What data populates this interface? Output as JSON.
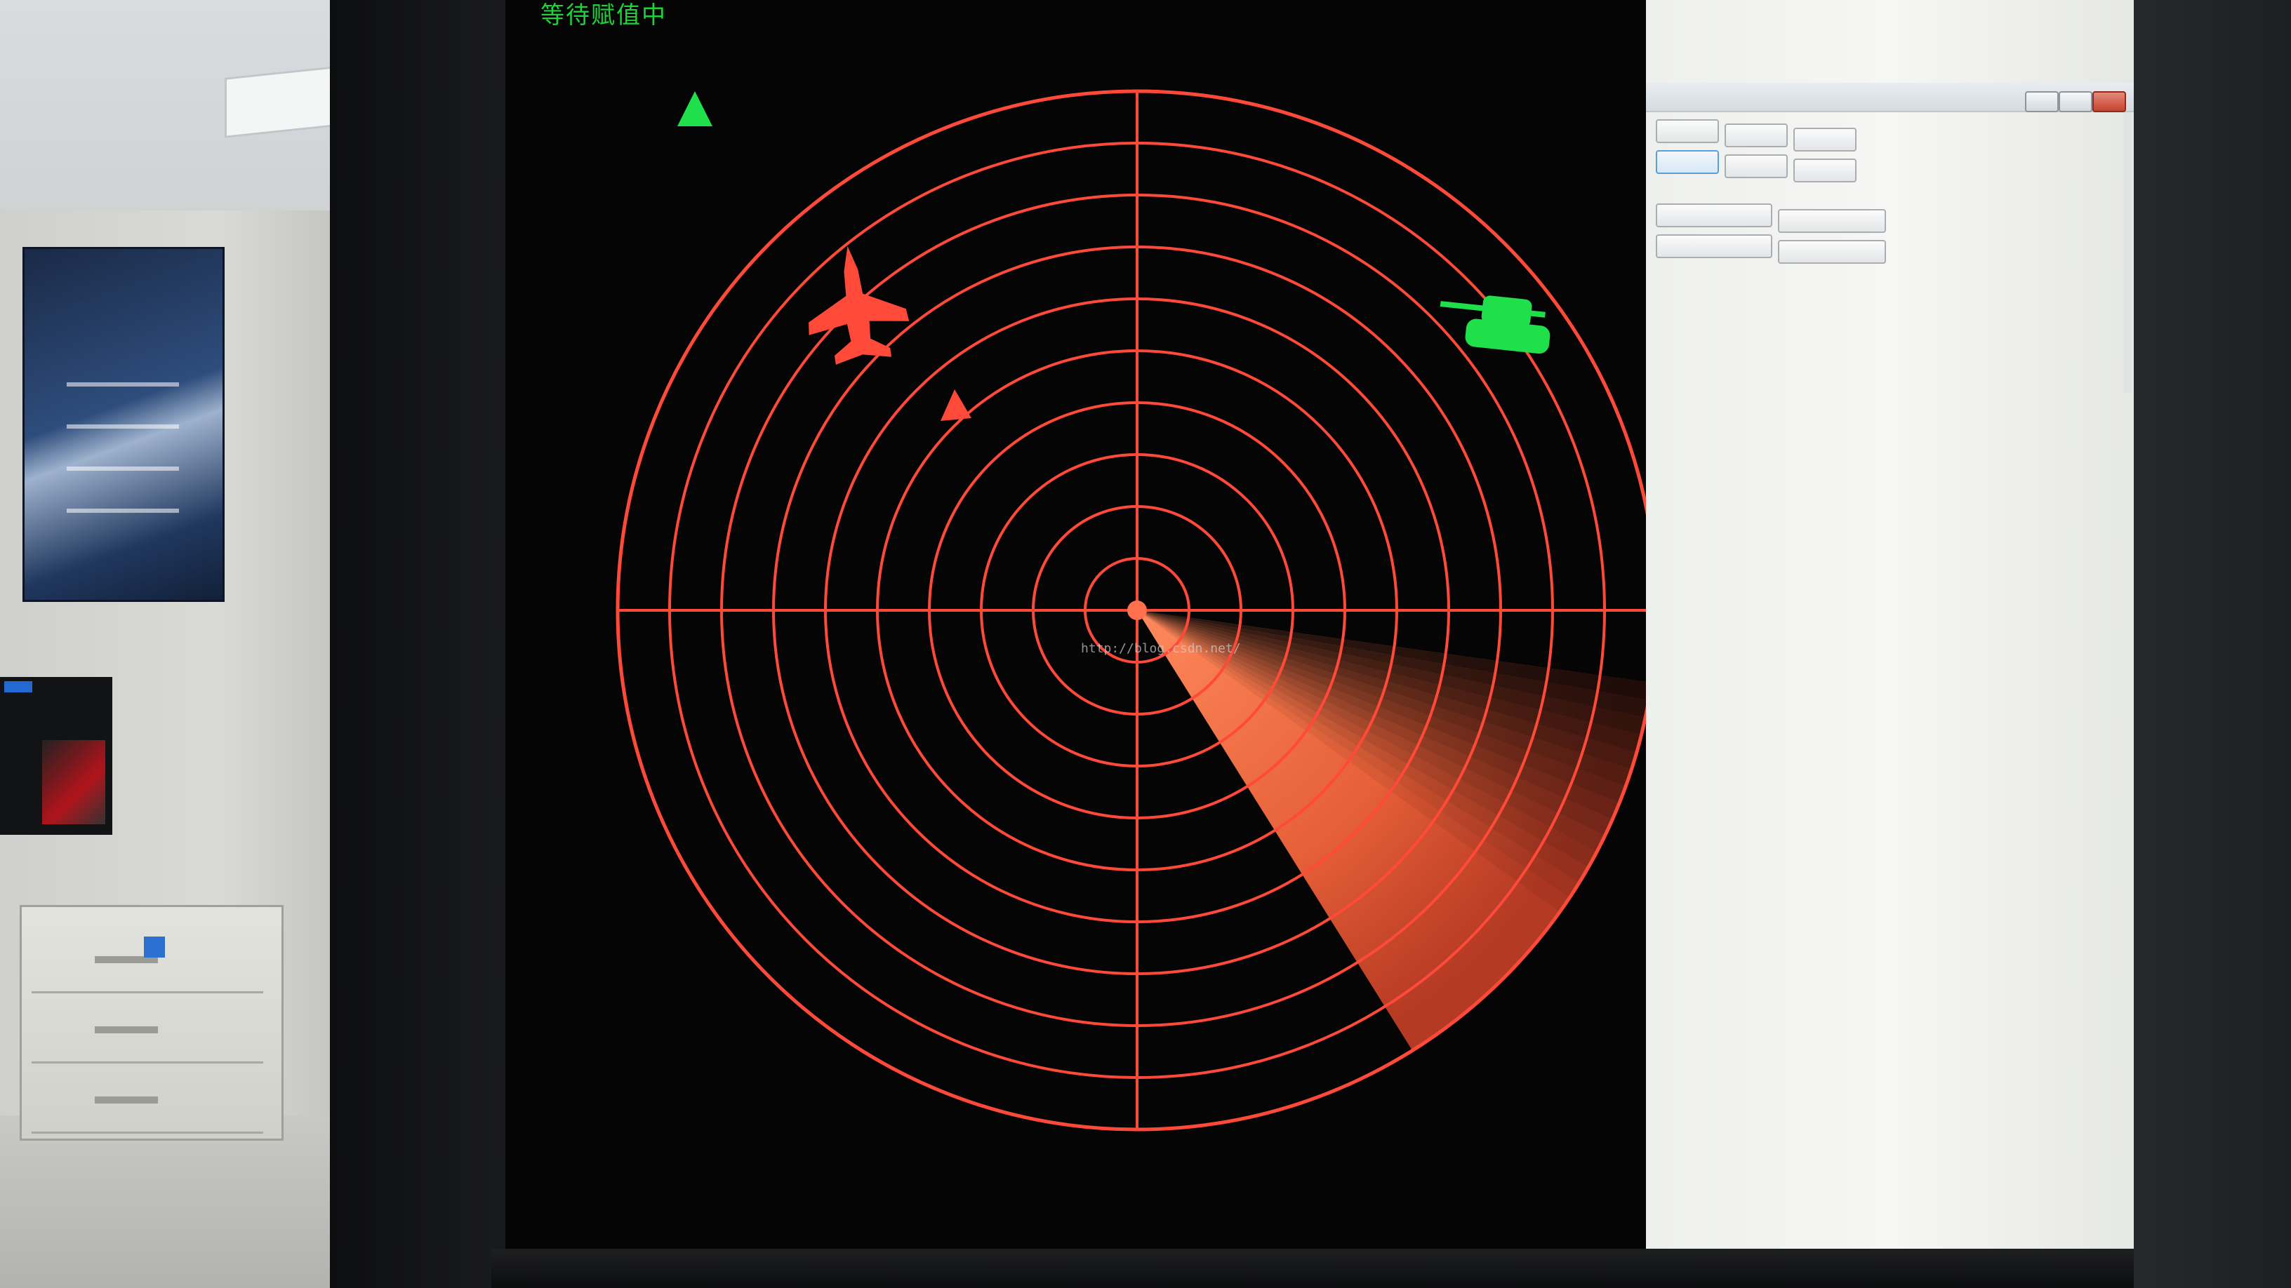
{
  "app": {
    "status_text": "等待赋值中"
  },
  "radar": {
    "ring_count": 10,
    "sweep": {
      "start_angle_deg": 8,
      "end_angle_deg": 58
    },
    "colors": {
      "grid": "#ff4a3a",
      "background": "#050505",
      "sweep": "#ff7a50",
      "friendly": "#1fe04a",
      "hostile": "#ff4a3a"
    },
    "watermark": "http://blog.csdn.net/",
    "targets": [
      {
        "kind": "fighter-jet",
        "side": "hostile"
      },
      {
        "kind": "triangle-marker",
        "side": "hostile"
      },
      {
        "kind": "tank",
        "side": "friendly"
      },
      {
        "kind": "triangle-marker",
        "side": "friendly"
      }
    ]
  },
  "panel": {
    "buttons_row1": [
      "",
      "",
      ""
    ],
    "buttons_row2": [
      "",
      "",
      ""
    ],
    "buttons_row3": [
      "",
      ""
    ],
    "buttons_row4": [
      "",
      ""
    ],
    "window_controls": [
      "minimize-icon",
      "maximize-icon",
      "close-icon"
    ]
  }
}
